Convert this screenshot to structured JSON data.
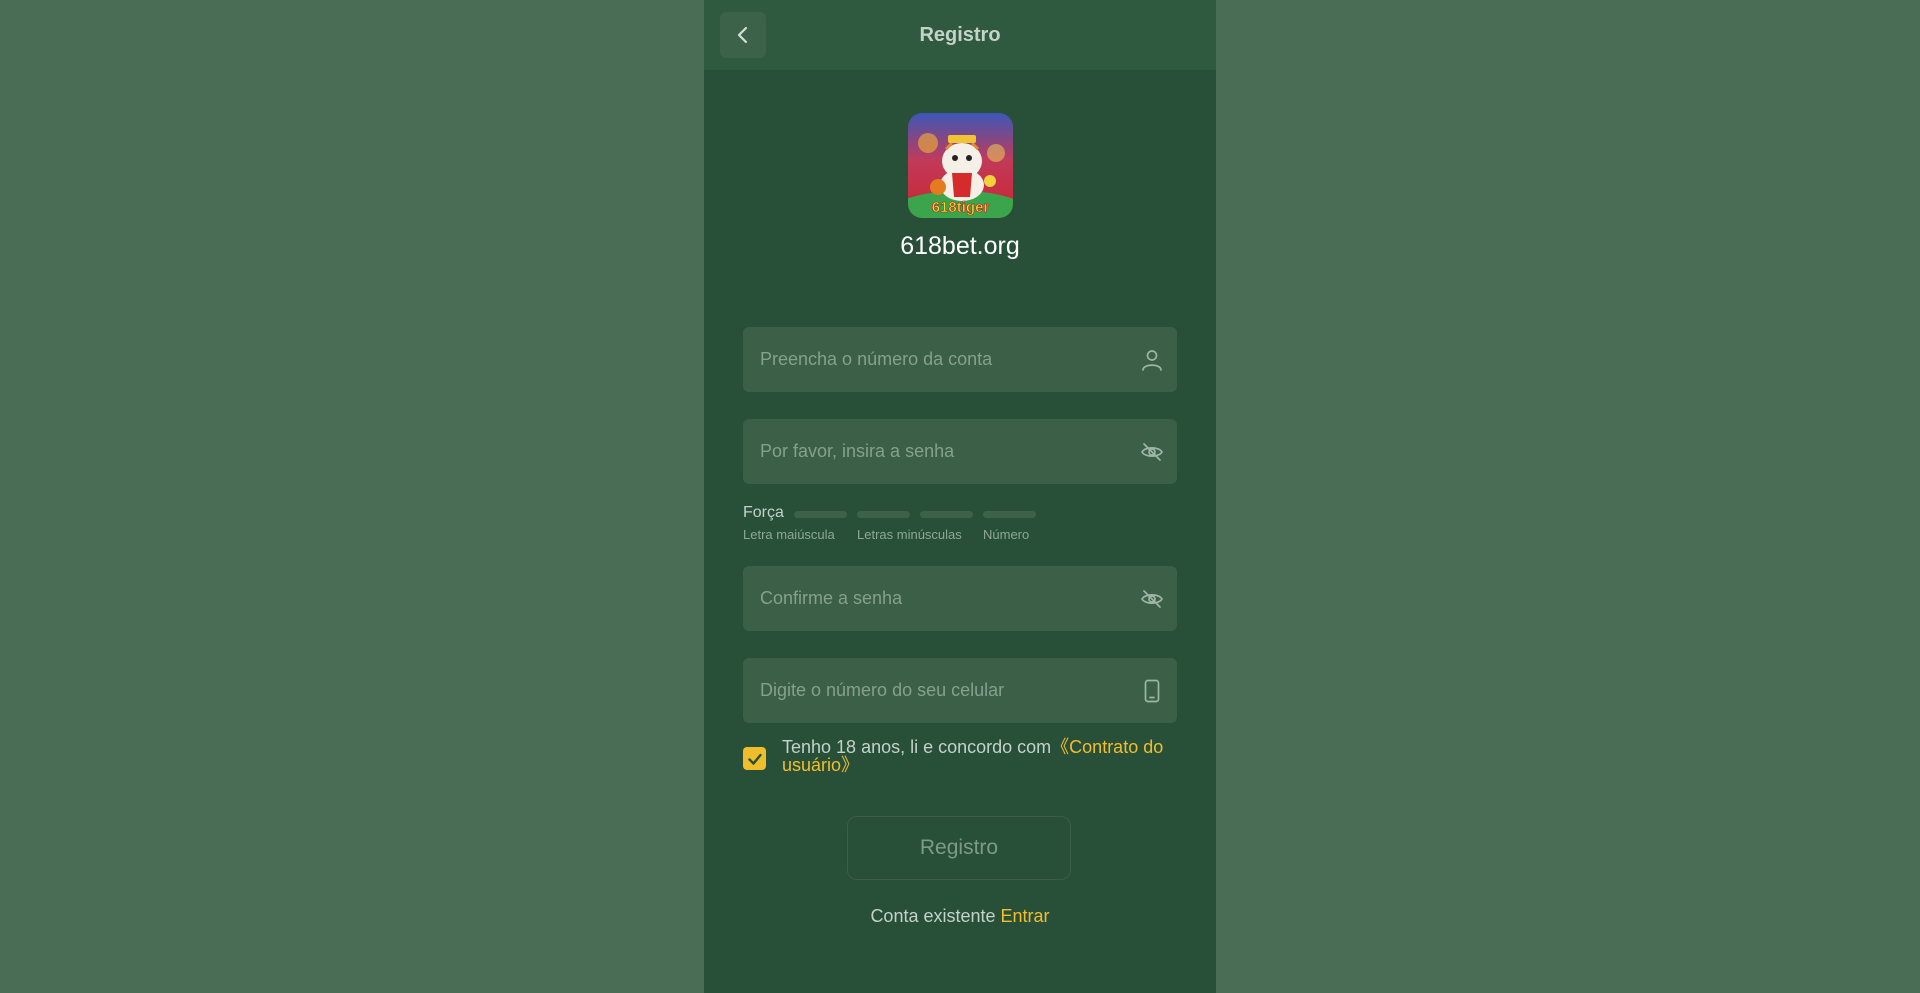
{
  "header": {
    "title": "Registro",
    "back_icon": "chevron-left-icon"
  },
  "brand": {
    "logo_text": "618tiger",
    "site_name": "618bet.org"
  },
  "form": {
    "account": {
      "value": "",
      "placeholder": "Preencha o número da conta",
      "icon": "user-icon"
    },
    "password": {
      "value": "",
      "placeholder": "Por favor, insira a senha",
      "icon": "eye-off-icon"
    },
    "strength": {
      "label": "Força",
      "level": 0,
      "hints": [
        "Letra maiúscula",
        "Letras minúsculas",
        "Número"
      ]
    },
    "confirm_password": {
      "value": "",
      "placeholder": "Confirme a senha",
      "icon": "eye-off-icon"
    },
    "phone": {
      "value": "",
      "placeholder": "Digite o número do seu celular",
      "icon": "phone-icon"
    },
    "agreement": {
      "checked": true,
      "text": "Tenho 18 anos, li e concordo com",
      "link": "《Contrato do usuário》"
    },
    "submit_label": "Registro"
  },
  "footer": {
    "text": "Conta existente",
    "link": "Entrar"
  },
  "colors": {
    "background": "#4a6d55",
    "panel": "#284f37",
    "field": "#3b5f47",
    "accent": "#f2be2e"
  }
}
